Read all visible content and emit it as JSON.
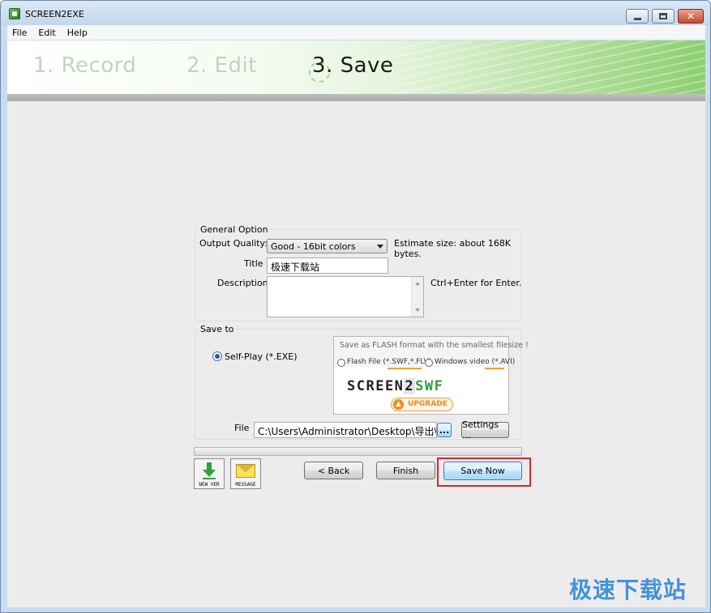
{
  "window": {
    "title": "SCREEN2EXE"
  },
  "menu": [
    "File",
    "Edit",
    "Help"
  ],
  "steps": {
    "record": "1. Record",
    "edit": "2. Edit",
    "save": "3. Save"
  },
  "general": {
    "legend": "General Option",
    "quality_label": "Output Quality:",
    "quality_value": "Good - 16bit colors",
    "estimate": "Estimate size: about 168K",
    "estimate2": "bytes.",
    "title_label": "Title",
    "title_value": "极速下载站",
    "desc_label": "Description",
    "desc_hint": "Ctrl+Enter for Enter."
  },
  "saveto": {
    "legend": "Save to",
    "self_play": "Self-Play (*.EXE)",
    "promo_head": "Save as FLASH format with the smallest filesize !",
    "flash_option": "Flash File (*.SWF,*.FLV)",
    "video_option": "Windows video (*.AVI)",
    "logo_part1": "SCREEN",
    "logo_part2": "2",
    "logo_part3": "SWF",
    "upgrade": "UPGRADE",
    "file_label": "File",
    "file_value": "C:\\Users\\Administrator\\Desktop\\导出\\极速下",
    "browse": "...",
    "settings": "Settings ..."
  },
  "buttons": {
    "new_ver": "NEW VER",
    "message": "MESSAGE",
    "back": "< Back",
    "finish": "Finish",
    "save_now": "Save Now"
  },
  "watermark": "极速下载站"
}
